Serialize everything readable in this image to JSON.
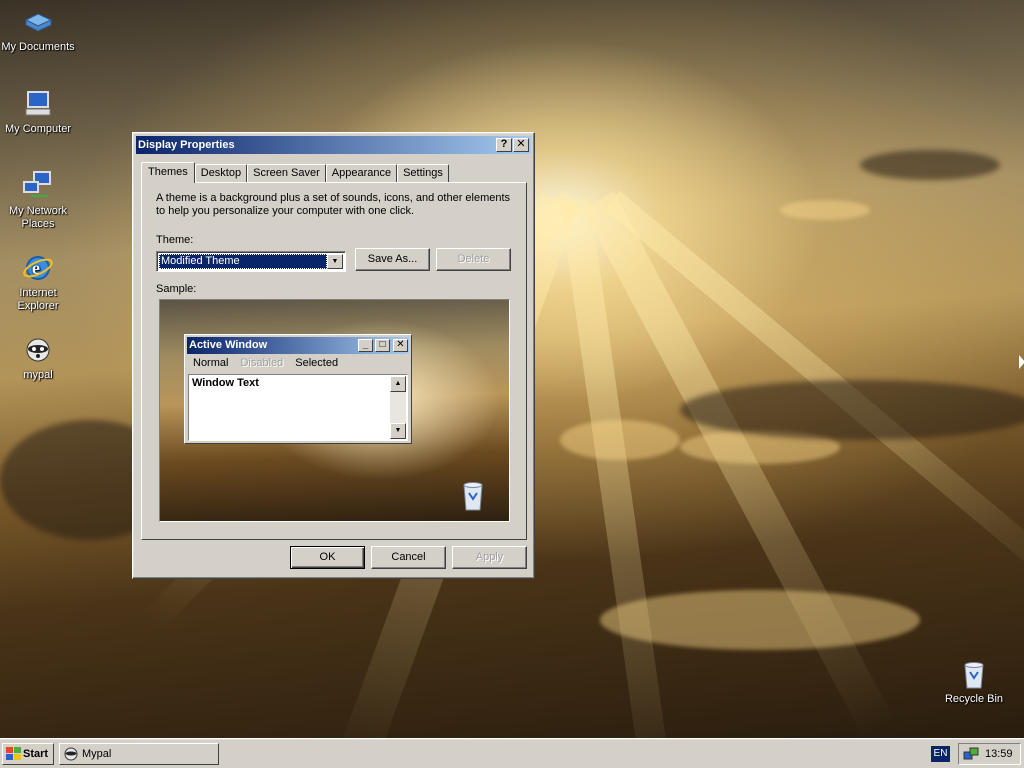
{
  "desktop": {
    "icons": [
      {
        "label": "My Documents",
        "icon": "my-documents-icon"
      },
      {
        "label": "My Computer",
        "icon": "my-computer-icon"
      },
      {
        "label": "My Network Places",
        "icon": "network-places-icon"
      },
      {
        "label": "Internet Explorer",
        "icon": "internet-explorer-icon"
      },
      {
        "label": "mypal",
        "icon": "mypal-raccoon-icon"
      },
      {
        "label": "Recycle Bin",
        "icon": "recycle-bin-icon"
      }
    ]
  },
  "dialog": {
    "title": "Display Properties",
    "help_button": "?",
    "close_button": "✕",
    "tabs": [
      "Themes",
      "Desktop",
      "Screen Saver",
      "Appearance",
      "Settings"
    ],
    "active_tab": "Themes",
    "description": "A theme is a background plus a set of sounds, icons, and other elements to help you personalize your computer with one click.",
    "theme_label": "Theme:",
    "theme_value": "Modified Theme",
    "save_as_label": "Save As...",
    "delete_label": "Delete",
    "sample_label": "Sample:",
    "sample": {
      "window_title": "Active Window",
      "menu": [
        "Normal",
        "Disabled",
        "Selected"
      ],
      "window_text": "Window Text"
    },
    "ok_label": "OK",
    "cancel_label": "Cancel",
    "apply_label": "Apply"
  },
  "taskbar": {
    "start_label": "Start",
    "tasks": [
      {
        "label": "Mypal",
        "icon": "mypal-raccoon-icon"
      }
    ],
    "language": "EN",
    "clock": "13:59"
  },
  "colors": {
    "title_active_start": "#0a246a",
    "title_active_end": "#a6caf0",
    "face": "#d4d0c8"
  }
}
